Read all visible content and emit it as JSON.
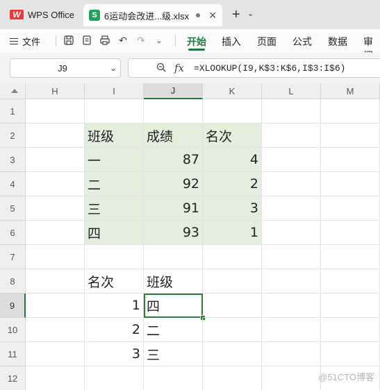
{
  "tabs": {
    "app": "WPS Office",
    "app_logo": "W",
    "file_icon": "S",
    "file_name": "6运动会改进...级.xlsx"
  },
  "ribbon": {
    "file_menu": "文件",
    "tabs": [
      "开始",
      "插入",
      "页面",
      "公式",
      "数据",
      "审阅"
    ],
    "active_tab": "开始",
    "accent_color": "#1f7a3a"
  },
  "formula_bar": {
    "cell_ref": "J9",
    "fx": "fx",
    "formula": "=XLOOKUP(I9,K$3:K$6,I$3:I$6)"
  },
  "grid": {
    "columns": [
      "H",
      "I",
      "J",
      "K",
      "L",
      "M"
    ],
    "selected_column": "J",
    "rows": [
      "1",
      "2",
      "3",
      "4",
      "5",
      "6",
      "7",
      "8",
      "9",
      "10",
      "11",
      "12"
    ],
    "selected_row": "9",
    "cells": {
      "I2": "班级",
      "J2": "成绩",
      "K2": "名次",
      "I3": "一",
      "J3": "87",
      "K3": "4",
      "I4": "二",
      "J4": "92",
      "K4": "2",
      "I5": "三",
      "J5": "91",
      "K5": "3",
      "I6": "四",
      "J6": "93",
      "K6": "1",
      "I8": "名次",
      "J8": "班级",
      "I9": "1",
      "J9": "四",
      "I10": "2",
      "J10": "二",
      "I11": "3",
      "J11": "三"
    },
    "highlight_color": "#e3efdc",
    "selected_cell": "J9"
  },
  "watermark": "@51CTO博客"
}
